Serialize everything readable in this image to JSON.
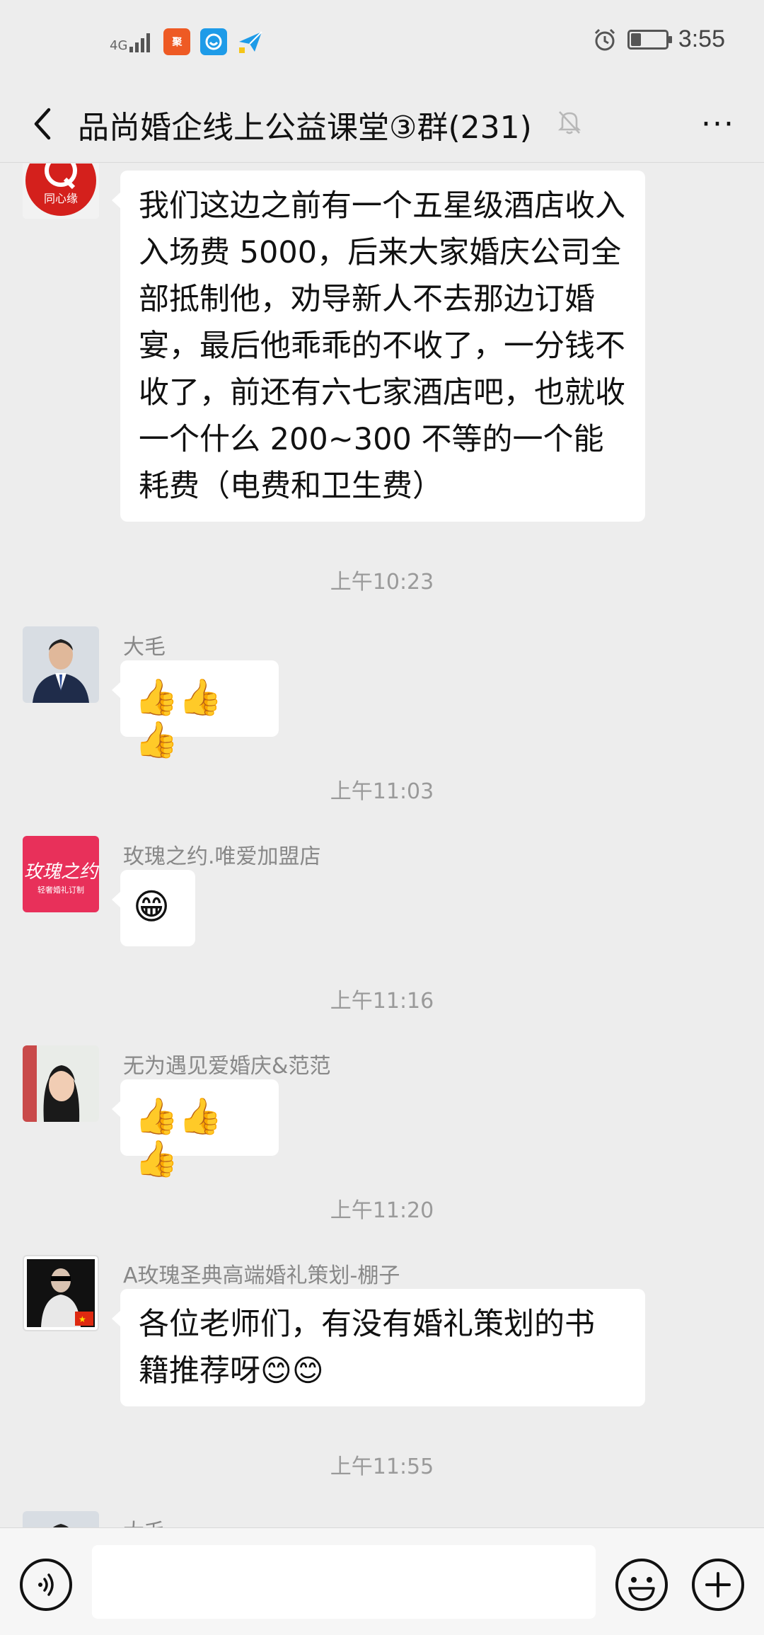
{
  "status_bar": {
    "signal": "4G",
    "app_icon_1": "聚",
    "time": "3:55",
    "battery_level": 0.3,
    "icons": [
      "signal-icon",
      "app-orange-icon",
      "app-blue-icon",
      "paper-plane-icon",
      "alarm-icon",
      "battery-icon"
    ]
  },
  "header": {
    "title": "品尚婚企线上公益课堂③群(231)",
    "back_icon": "chevron-left-icon",
    "mute_icon": "bell-off-icon",
    "more_label": "···"
  },
  "messages": [
    {
      "avatar_text": "同心缘",
      "text": "我们这边之前有一个五星级酒店收入入场费 5000，后来大家婚庆公司全部抵制他，劝导新人不去那边订婚宴，最后他乖乖的不收了，一分钱不收了，前还有六七家酒店吧，也就收一个什么 200~300 不等的一个能耗费（电费和卫生费）"
    },
    {
      "time": "上午10:23",
      "sender": "大毛",
      "content": "👍👍👍"
    },
    {
      "time": "上午11:03",
      "sender": "玫瑰之约.唯爱加盟店",
      "avatar_text": "玫瑰之约",
      "avatar_sub": "轻奢婚礼订制",
      "content": "😁"
    },
    {
      "time": "上午11:16",
      "sender": "无为遇见爱婚庆&范范",
      "content": "👍👍👍"
    },
    {
      "time": "上午11:20",
      "sender": "A玫瑰圣典高端婚礼策划-棚子",
      "line1": "各位老师们，有没有婚礼策划的书",
      "line2": "籍推荐呀",
      "emojis": "😊😊"
    },
    {
      "time": "上午11:55",
      "sender": "大毛"
    }
  ],
  "input_bar": {
    "placeholder": "",
    "icons": [
      "voice-icon",
      "emoji-icon",
      "plus-icon"
    ]
  },
  "colors": {
    "background": "#ededed",
    "bubble": "#ffffff",
    "timestamp": "#9a9a9a",
    "rose_brand": "#e8305a",
    "tongxin_red": "#d4201c"
  }
}
